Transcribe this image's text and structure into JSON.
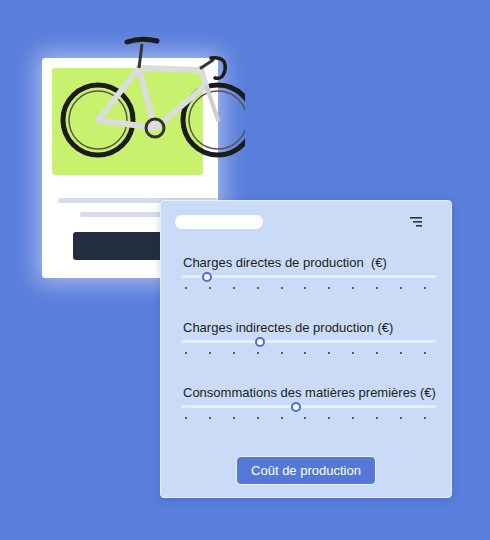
{
  "panel": {
    "sliders": [
      {
        "label": "Charges directes de production  (€)",
        "level": 0.1
      },
      {
        "label": "Charges indirectes de production (€)",
        "level": 0.31
      },
      {
        "label": "Consommations des matières premières (€)",
        "level": 0.45
      }
    ],
    "button": "Coût de production"
  }
}
